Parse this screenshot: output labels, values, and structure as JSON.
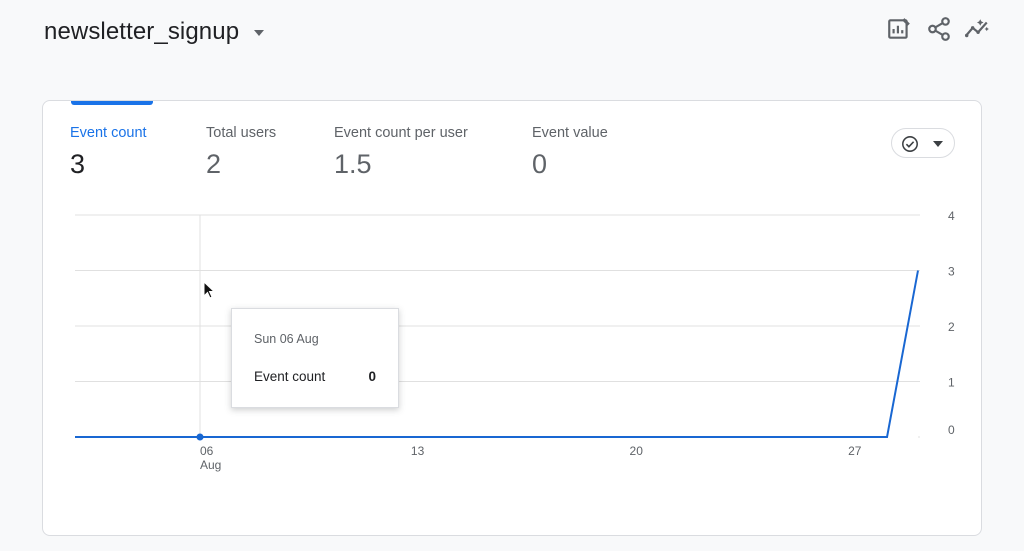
{
  "header": {
    "title": "newsletter_signup",
    "actions": [
      {
        "name": "customize-report-icon"
      },
      {
        "name": "share-icon"
      },
      {
        "name": "insights-icon"
      }
    ]
  },
  "metrics": [
    {
      "label": "Event count",
      "value": "3",
      "active": true
    },
    {
      "label": "Total users",
      "value": "2",
      "active": false
    },
    {
      "label": "Event count per user",
      "value": "1.5",
      "active": false
    },
    {
      "label": "Event value",
      "value": "0",
      "active": false
    }
  ],
  "tooltip": {
    "date": "Sun 06 Aug",
    "metric": "Event count",
    "value": "0"
  },
  "colors": {
    "accent": "#1a73e8",
    "line": "#1967d2",
    "grid": "#e0e0e0"
  },
  "chart_data": {
    "type": "line",
    "x_tick_labels": [
      "06",
      "13",
      "20",
      "27"
    ],
    "x_tick_sublabels": [
      "Aug",
      "",
      "",
      ""
    ],
    "y_tick_labels": [
      "0",
      "1",
      "2",
      "3",
      "4"
    ],
    "ylim": [
      0,
      4
    ],
    "grid": true,
    "series": [
      {
        "x": [
          "Aug 01",
          "Aug 02",
          "Aug 03",
          "Aug 04",
          "Aug 05",
          "Aug 06",
          "Aug 07",
          "Aug 08",
          "Aug 09",
          "Aug 10",
          "Aug 11",
          "Aug 12",
          "Aug 13",
          "Aug 14",
          "Aug 15",
          "Aug 16",
          "Aug 17",
          "Aug 18",
          "Aug 19",
          "Aug 20",
          "Aug 21",
          "Aug 22",
          "Aug 23",
          "Aug 24",
          "Aug 25",
          "Aug 26",
          "Aug 27",
          "Aug 28",
          "Aug 29"
        ],
        "values": [
          0,
          0,
          0,
          0,
          0,
          0,
          0,
          0,
          0,
          0,
          0,
          0,
          0,
          0,
          0,
          0,
          0,
          0,
          0,
          0,
          0,
          0,
          0,
          0,
          0,
          0,
          0,
          0,
          3
        ]
      }
    ],
    "highlighted_point": {
      "x": "Aug 06",
      "y": 0
    }
  }
}
